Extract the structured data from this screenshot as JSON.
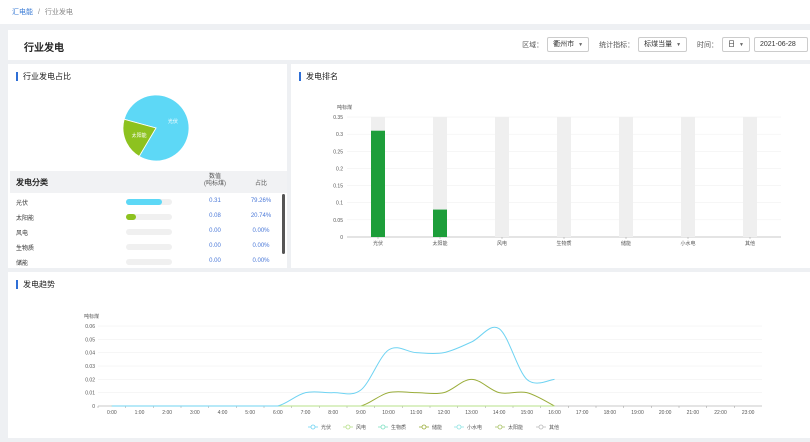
{
  "breadcrumb": {
    "root": "汇电能",
    "sep": "/",
    "current": "行业发电"
  },
  "header": {
    "title": "行业发电",
    "region_label": "区域：",
    "region_value": "衢州市",
    "metric_label": "统计指标：",
    "metric_value": "标煤当量",
    "time_label": "时间：",
    "time_unit": "日",
    "date_value": "2021-06-28"
  },
  "share_panel": {
    "title": "行业发电占比",
    "table_header": {
      "category": "发电分类",
      "value_l1": "数值",
      "value_l2": "(吨标煤)",
      "percent": "占比"
    },
    "rows": [
      {
        "name": "光伏",
        "value": "0.31",
        "percent": "79.26%",
        "fill": 0.79,
        "color": "#5dd8f6"
      },
      {
        "name": "太阳能",
        "value": "0.08",
        "percent": "20.74%",
        "fill": 0.21,
        "color": "#8dc21f"
      },
      {
        "name": "风电",
        "value": "0.00",
        "percent": "0.00%",
        "fill": 0,
        "color": "#5dd8f6"
      },
      {
        "name": "生物质",
        "value": "0.00",
        "percent": "0.00%",
        "fill": 0,
        "color": "#5dd8f6"
      },
      {
        "name": "储能",
        "value": "0.00",
        "percent": "0.00%",
        "fill": 0,
        "color": "#5dd8f6"
      }
    ]
  },
  "rank_panel": {
    "title": "发电排名"
  },
  "trend_panel": {
    "title": "发电趋势"
  },
  "chart_data": [
    {
      "type": "pie",
      "categories": [
        "光伏",
        "太阳能"
      ],
      "values": [
        79.26,
        20.74
      ],
      "colors": [
        "#5dd8f6",
        "#8dc21f"
      ]
    },
    {
      "type": "bar",
      "ylabel": "吨标煤",
      "categories": [
        "光伏",
        "太阳能",
        "风电",
        "生物质",
        "储能",
        "小水电",
        "其他"
      ],
      "values": [
        0.31,
        0.08,
        0,
        0,
        0,
        0,
        0
      ],
      "ylim": [
        0,
        0.35
      ],
      "yticks": [
        "0",
        "0.05",
        "0.1",
        "0.15",
        "0.2",
        "0.25",
        "0.3",
        "0.35"
      ],
      "bar_color": "#1d9e3a",
      "bg_color": "#efefef"
    },
    {
      "type": "line",
      "ylabel": "吨标煤",
      "x": [
        "0:00",
        "1:00",
        "2:00",
        "3:00",
        "4:00",
        "5:00",
        "6:00",
        "7:00",
        "8:00",
        "9:00",
        "10:00",
        "11:00",
        "12:00",
        "13:00",
        "14:00",
        "15:00",
        "16:00",
        "17:00",
        "18:00",
        "19:00",
        "20:00",
        "21:00",
        "22:00",
        "23:00"
      ],
      "ylim": [
        0,
        0.06
      ],
      "yticks": [
        "0",
        "0.01",
        "0.02",
        "0.03",
        "0.04",
        "0.05",
        "0.06"
      ],
      "legend_position": "bottom",
      "series": [
        {
          "name": "光伏",
          "color": "#6fd3f2",
          "values": [
            0,
            0,
            0,
            0,
            0,
            0,
            0,
            0.01,
            0.01,
            0.012,
            0.042,
            0.04,
            0.04,
            0.048,
            0.058,
            0.02,
            0.02,
            null,
            null,
            null,
            null,
            null,
            null,
            null
          ]
        },
        {
          "name": "风电",
          "color": "#b7e08a",
          "values": [
            0,
            0,
            0,
            0,
            0,
            0,
            0,
            0,
            0,
            0,
            0,
            0,
            0,
            0,
            0,
            0,
            0,
            null,
            null,
            null,
            null,
            null,
            null,
            null
          ]
        },
        {
          "name": "生物质",
          "color": "#7ee0c2",
          "values": [
            0,
            0,
            0,
            0,
            0,
            0,
            0,
            0,
            0,
            0,
            0,
            0,
            0,
            0,
            0,
            0,
            0,
            null,
            null,
            null,
            null,
            null,
            null,
            null
          ]
        },
        {
          "name": "储能",
          "color": "#9aad3a",
          "values": [
            0,
            0,
            0,
            0,
            0,
            0,
            0,
            0,
            0,
            0,
            0.01,
            0.01,
            0.01,
            0.02,
            0.01,
            0.01,
            0,
            null,
            null,
            null,
            null,
            null,
            null,
            null
          ]
        },
        {
          "name": "小水电",
          "color": "#8fe3e3",
          "values": [
            0,
            0,
            0,
            0,
            0,
            0,
            0,
            0,
            0,
            0,
            0,
            0,
            0,
            0,
            0,
            0,
            0,
            null,
            null,
            null,
            null,
            null,
            null,
            null
          ]
        },
        {
          "name": "太阳能",
          "color": "#a8c266",
          "values": [
            0,
            0,
            0,
            0,
            0,
            0,
            0,
            0,
            0,
            0,
            0,
            0,
            0,
            0,
            0,
            0,
            0,
            null,
            null,
            null,
            null,
            null,
            null,
            null
          ]
        },
        {
          "name": "其他",
          "color": "#bbbbbb",
          "values": [
            0,
            0,
            0,
            0,
            0,
            0,
            0,
            0,
            0,
            0,
            0,
            0,
            0,
            0,
            0,
            0,
            0,
            null,
            null,
            null,
            null,
            null,
            null,
            null
          ]
        }
      ]
    }
  ]
}
